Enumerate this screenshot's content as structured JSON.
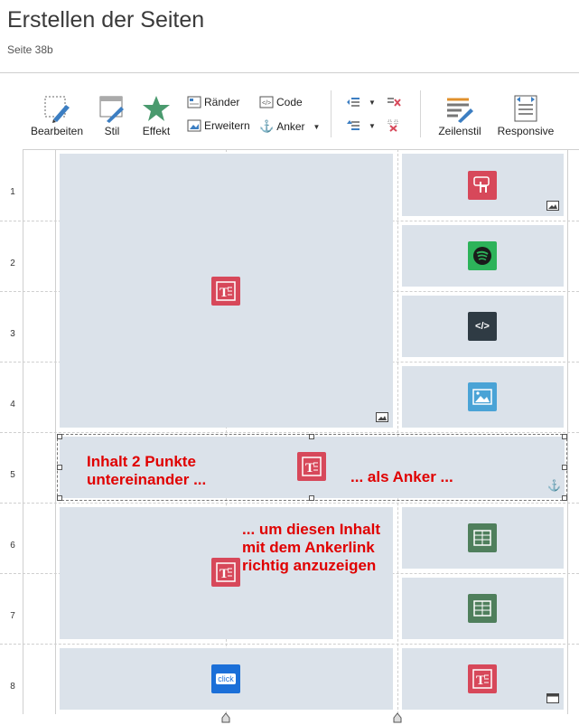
{
  "header": {
    "title": "Erstellen der Seiten",
    "subtitle": "Seite 38b"
  },
  "toolbar": {
    "bearbeiten": "Bearbeiten",
    "stil": "Stil",
    "effekt": "Effekt",
    "raender": "Ränder",
    "erweitern": "Erweitern",
    "code": "Code",
    "anker": "Anker",
    "zeilenstil": "Zeilenstil",
    "responsive": "Responsive"
  },
  "rows": [
    "1",
    "2",
    "3",
    "4",
    "5",
    "6",
    "7",
    "8"
  ],
  "content": {
    "text_icon": "T",
    "code_icon": "</>",
    "click_icon": "click",
    "annotation_left": "Inhalt 2 Punkte\nuntereinander  ...",
    "annotation_anker": "... als Anker  ...",
    "annotation_link": "... um diesen Inhalt\nmit dem Ankerlink\nrichtig anzuzeigen"
  },
  "colors": {
    "cell_bg": "#dbe2ea",
    "text_icon": "#d7485a",
    "spotify": "#2db35a",
    "code": "#2f3b44",
    "image": "#4aa3d6",
    "table": "#4f7f5c",
    "click": "#1b6fd8",
    "annotation": "#e00000"
  }
}
